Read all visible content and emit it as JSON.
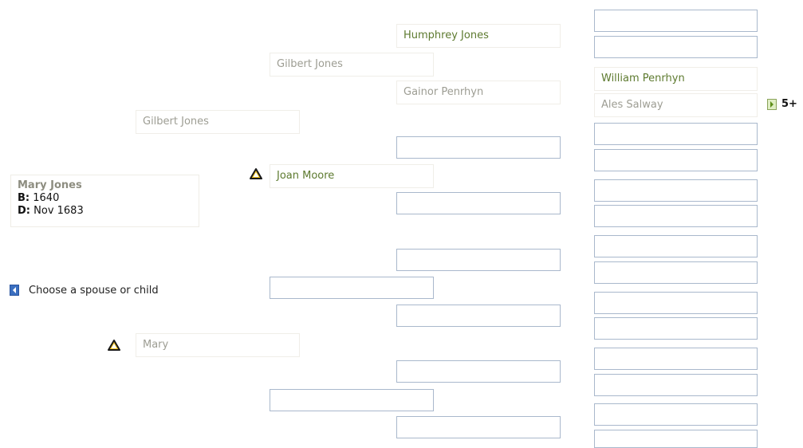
{
  "focus_person": {
    "name": "Mary Jones",
    "birth_label": "B:",
    "birth_value": "1640",
    "death_label": "D:",
    "death_value": "Nov 1683"
  },
  "spouse_nav": {
    "label": "Choose a spouse or child"
  },
  "ancestors": {
    "father": "Gilbert Jones",
    "paternal_grandfather": "Gilbert Jones",
    "paternal_gg_father": "Humphrey Jones",
    "paternal_gg_mother": "Gainor Penrhyn",
    "gen5_father": "William Penrhyn",
    "gen5_mother": "Ales Salway",
    "paternal_grandmother": "Joan Moore",
    "mother": "Mary"
  },
  "more_generations": {
    "label": "5+"
  },
  "colors": {
    "filled_name": "#5d7a2f",
    "grey_name": "#9d9d93",
    "empty_border": "#a9b8cc",
    "warning_fill": "#f2c21b"
  }
}
